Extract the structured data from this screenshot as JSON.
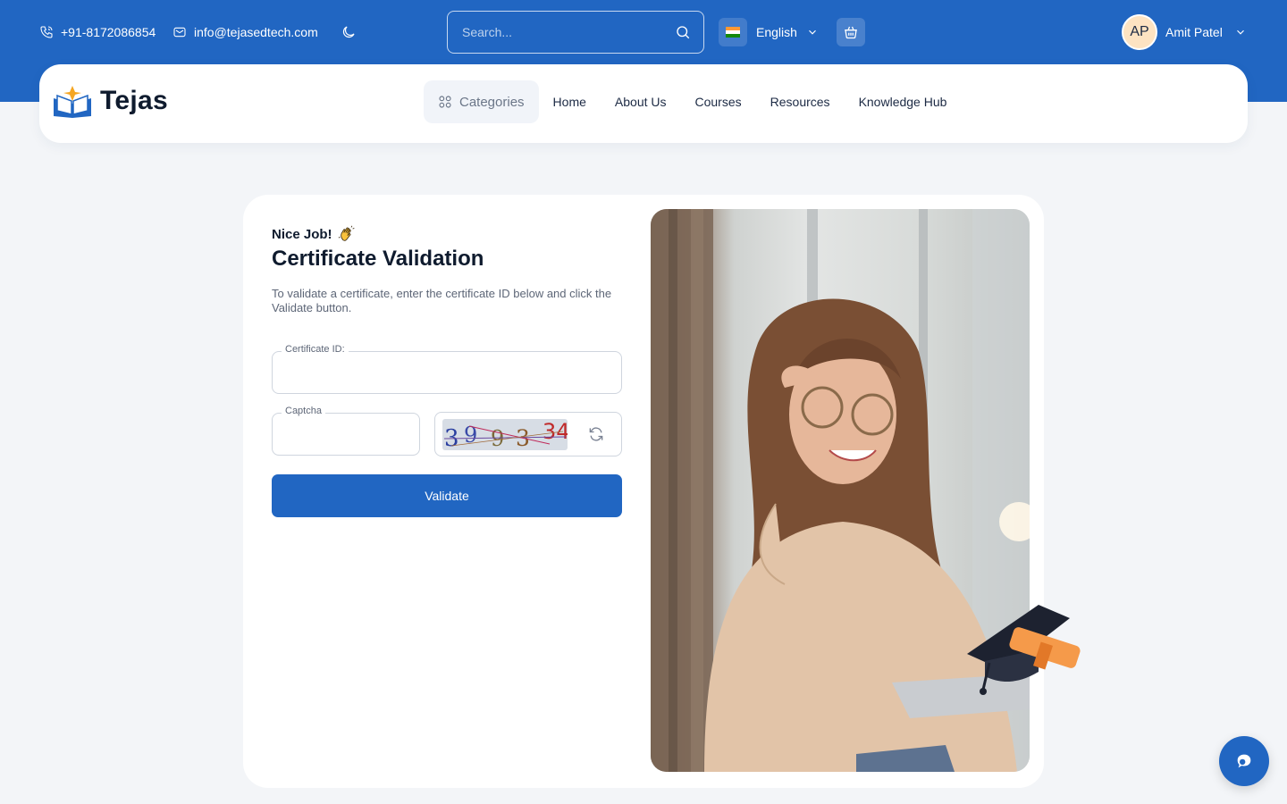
{
  "topbar": {
    "phone": "+91-8172086854",
    "email": "info@tejasedtech.com",
    "search_placeholder": "Search...",
    "language": "English",
    "user_initials": "AP",
    "user_name": "Amit Patel"
  },
  "navbar": {
    "brand": "Tejas",
    "categories_label": "Categories",
    "links": [
      "Home",
      "About Us",
      "Courses",
      "Resources",
      "Knowledge Hub"
    ]
  },
  "form": {
    "greeting": "Nice Job!",
    "title": "Certificate Validation",
    "description": "To validate a certificate, enter the certificate ID below and click the Validate button.",
    "certificate_label": "Certificate ID:",
    "certificate_value": "",
    "captcha_label": "Captcha",
    "captcha_value": "",
    "captcha_code": "399334",
    "validate_label": "Validate"
  },
  "colors": {
    "primary": "#2166c2",
    "page_bg": "#f3f5f8",
    "card_bg": "#ffffff",
    "heading": "#0f1b2e"
  },
  "icons": [
    "phone-icon",
    "mail-icon",
    "moon-icon",
    "search-icon",
    "india-flag-icon",
    "chevron-down-icon",
    "cart-icon",
    "categories-grid-icon",
    "wave-hand-icon",
    "refresh-icon",
    "chat-icon",
    "graduation-cap-icon"
  ]
}
